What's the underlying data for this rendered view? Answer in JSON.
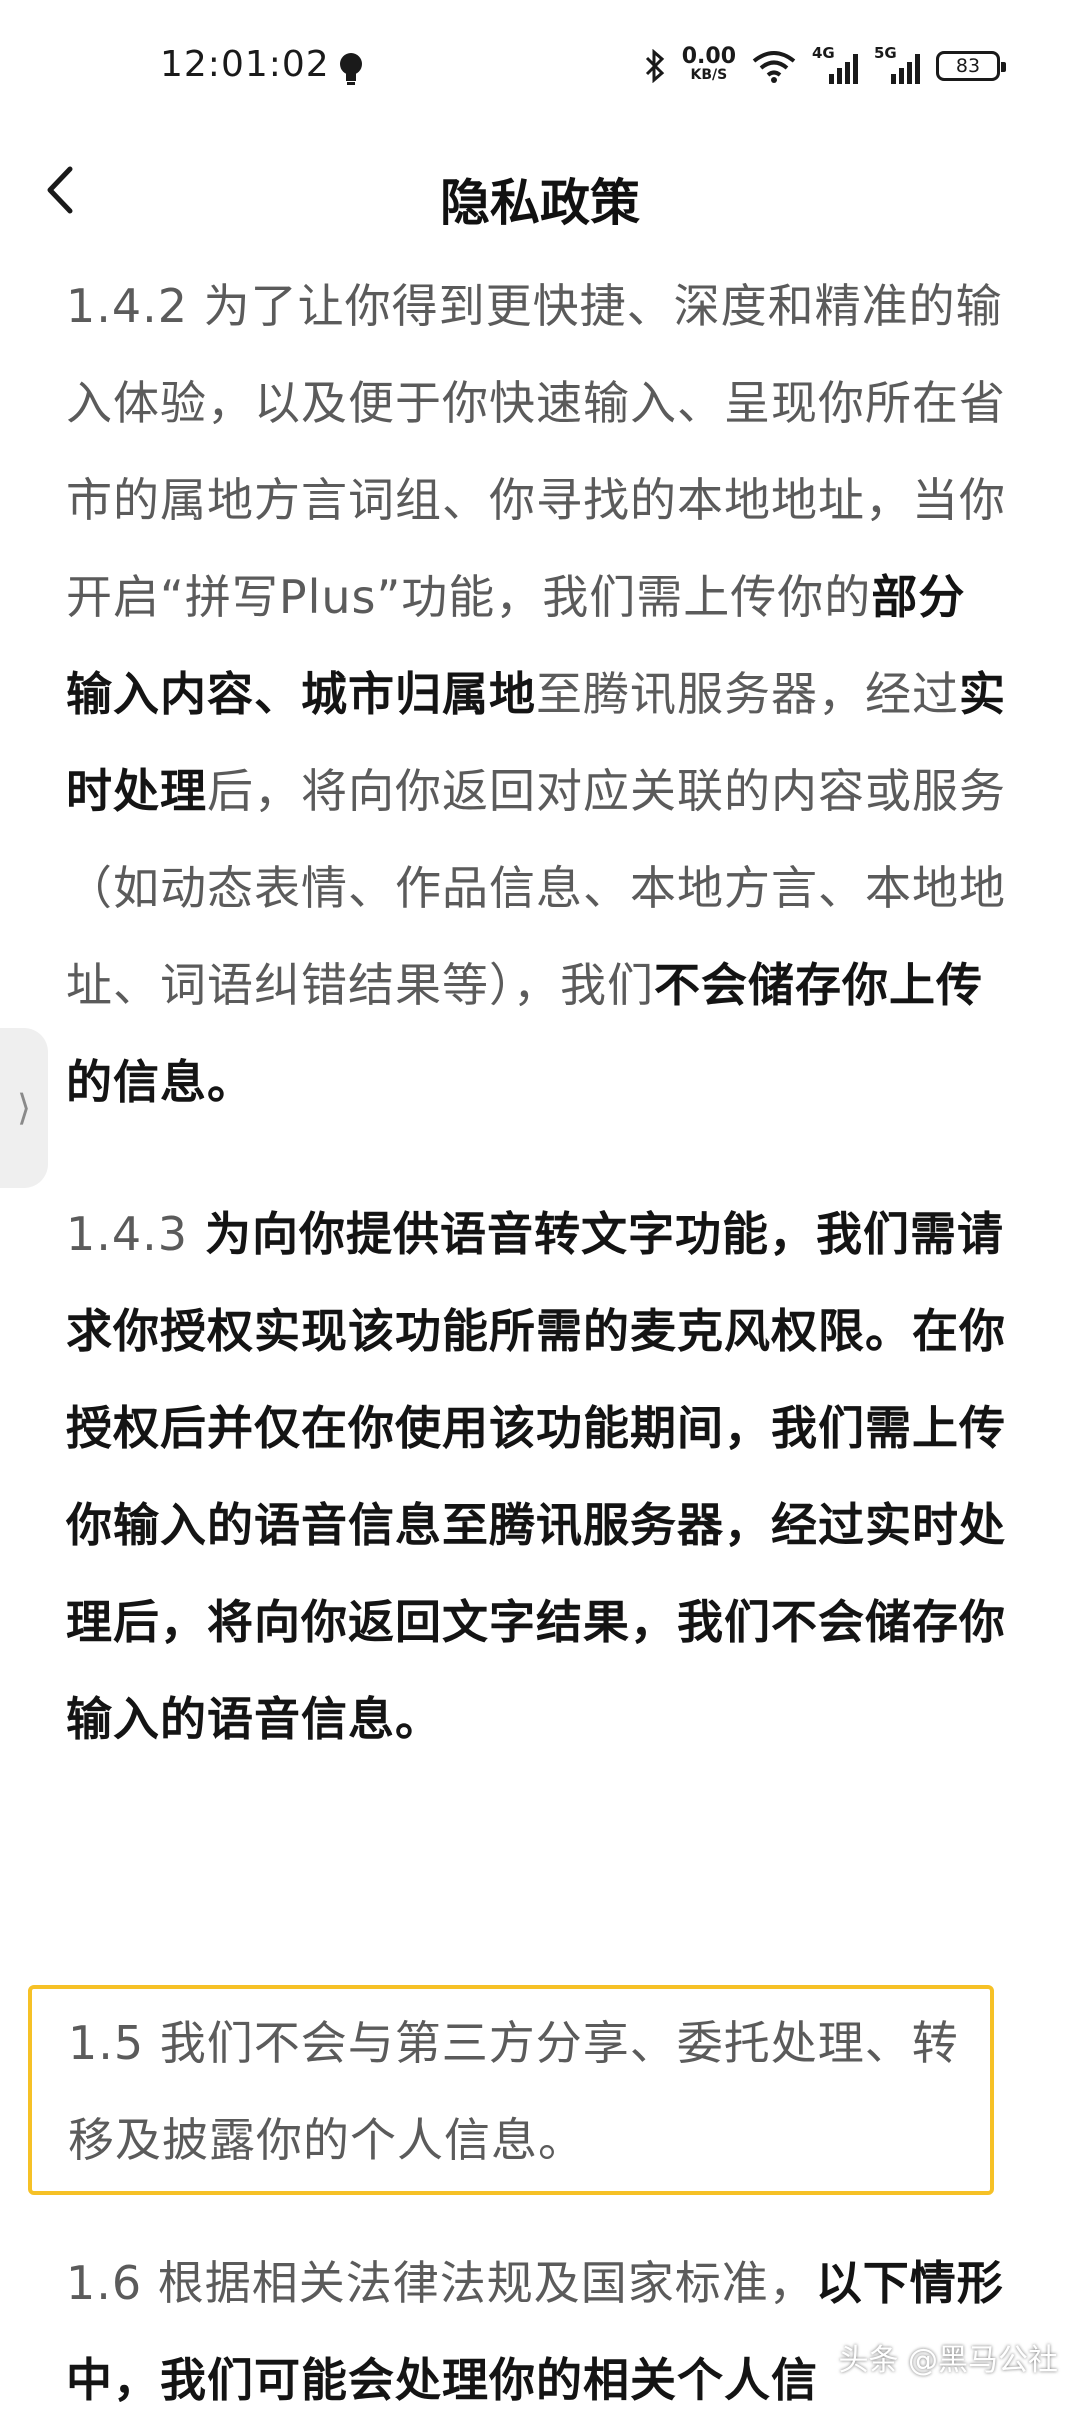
{
  "status_bar": {
    "time": "12:01:02",
    "net_speed_value": "0.00",
    "net_speed_unit": "KB/S",
    "sig1_label": "4G",
    "sig2_label": "5G",
    "battery": "83"
  },
  "header": {
    "title": "隐私政策"
  },
  "content": {
    "p142_num": "1.4.2",
    "p142_a": " 为了让你得到更快捷、深度和精准的输入体验，以及便于你快速输入、呈现你所在省市的属地方言词组、你寻找的本地地址，当你开启“拼写Plus”功能，我们需上传你的",
    "p142_b1": "部分输入内容、城市归属地",
    "p142_c": "至腾讯服务器，经过",
    "p142_b2": "实时处理",
    "p142_d": "后，将向你返回对应关联的内容或服务（如动态表情、作品信息、本地方言、本地地址、词语纠错结果等），我们",
    "p142_b3": "不会储存你上传的信息",
    "p142_e": "。",
    "p143_num": "1.4.3",
    "p143_b": " 为向你提供语音转文字功能，我们需请求你授权实现该功能所需的麦克风权限。在你授权后并仅在你使用该功能期间，我们需上传你输入的语音信息至腾讯服务器，经过实时处理后，将向你返回文字结果，我们不会储存你输入的语音信息",
    "p143_e": "。",
    "p15_text": "1.5 我们不会与第三方分享、委托处理、转移及披露你的个人信息。",
    "p16_a": "1.6 根据相关法律法规及国家标准，",
    "p16_b": "以下情形中，我们可能会处理你的相关个人信"
  },
  "watermark": "头条 @黑马公社"
}
